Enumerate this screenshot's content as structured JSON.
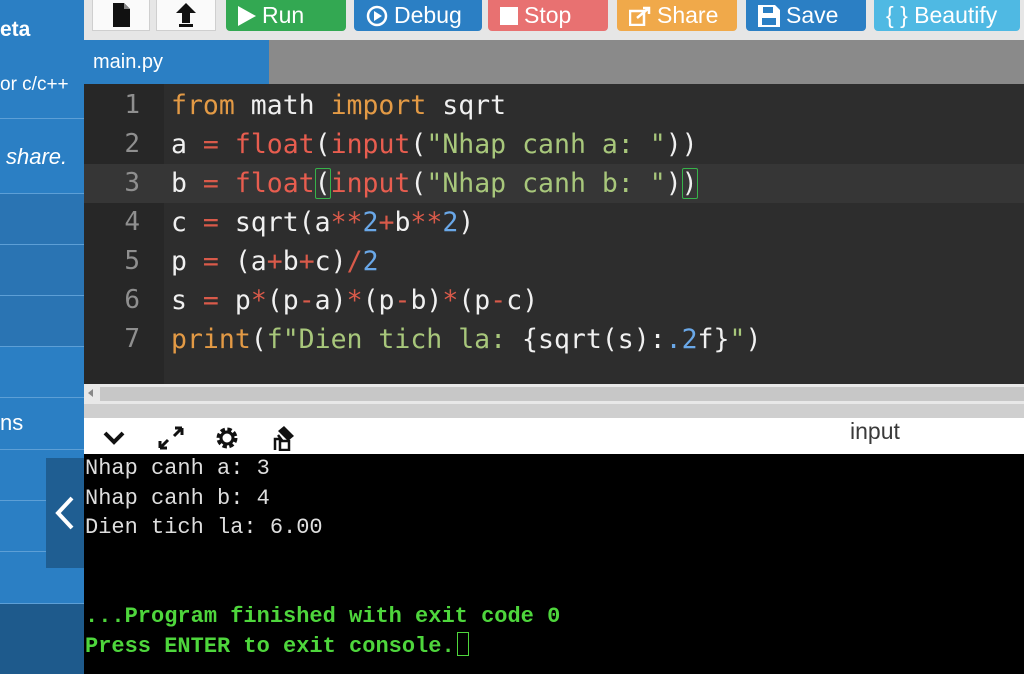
{
  "sidebar": {
    "title_fragment": "eta",
    "language_fragment": "or c/c++",
    "share_fragment": "share.",
    "section_fragment": "ns"
  },
  "toolbar": {
    "run_label": "Run",
    "debug_label": "Debug",
    "stop_label": "Stop",
    "share_label": "Share",
    "save_label": "Save",
    "beautify_label": "{ } Beautify"
  },
  "tabs": [
    {
      "label": "main.py"
    }
  ],
  "editor": {
    "lines": [
      {
        "number": "1",
        "text": "from math import sqrt"
      },
      {
        "number": "2",
        "text": "a = float(input(\"Nhap canh a: \"))"
      },
      {
        "number": "3",
        "text": "b = float(input(\"Nhap canh b: \"))"
      },
      {
        "number": "4",
        "text": "c = sqrt(a**2+b**2)"
      },
      {
        "number": "5",
        "text": "p = (a+b+c)/2"
      },
      {
        "number": "6",
        "text": "s = p*(p-a)*(p-b)*(p-c)"
      },
      {
        "number": "7",
        "text": "print(f\"Dien tich la: {sqrt(s):.2f}\")"
      }
    ]
  },
  "console": {
    "input_label": "input",
    "output": [
      "Nhap canh a: 3",
      "Nhap canh b: 4",
      "Dien tich la: 6.00",
      "",
      "",
      "...Program finished with exit code 0",
      "Press ENTER to exit console."
    ]
  },
  "colors": {
    "run": "#33a852",
    "debug": "#2b7fc4",
    "stop": "#e87171",
    "share": "#f0a94a",
    "save": "#2b7fc4",
    "beautify": "#4fb9e3"
  }
}
